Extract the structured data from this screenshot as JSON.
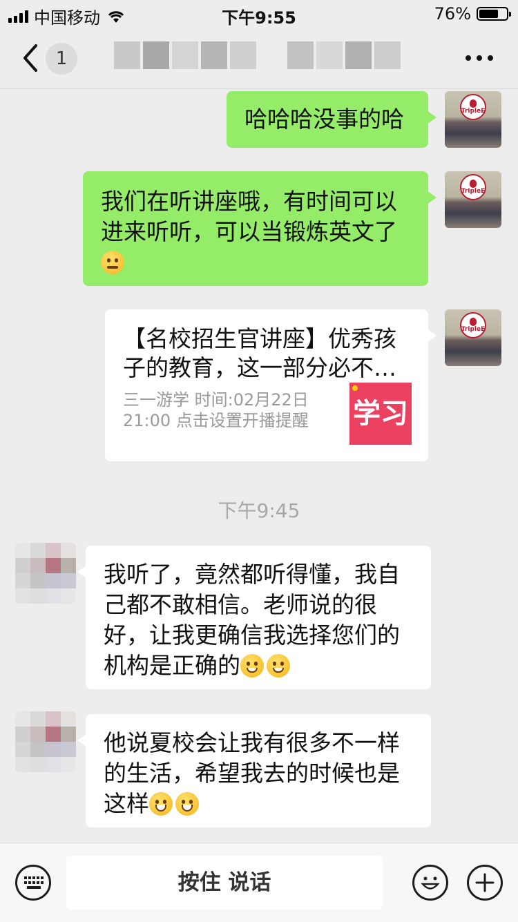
{
  "status_bar": {
    "carrier": "中国移动",
    "time": "下午9:55",
    "battery_text": "76%",
    "battery_level": 0.76
  },
  "nav": {
    "back_count": "1",
    "more_icon": "more-icon"
  },
  "messages": [
    {
      "side": "right",
      "type": "text",
      "text": "哈哈哈没事的哈"
    },
    {
      "side": "right",
      "type": "text",
      "lines": [
        "我们在听讲座哦，有时间可以",
        "进来听听，可以当锻炼英文了"
      ],
      "emoji": "thinking-emoji"
    },
    {
      "side": "right",
      "type": "card",
      "title_lines": [
        "【名校招生官讲座】优秀孩",
        "子的教育，这一部分必不…"
      ],
      "meta_lines": [
        "三一游学 时间:02月22日",
        "21:00 点击设置开播提醒"
      ],
      "thumb_text": "学习"
    }
  ],
  "timestamp": "下午9:45",
  "incoming": [
    {
      "side": "left",
      "type": "text",
      "lines": [
        "我听了，竟然都听得懂，我自",
        "己都不敢相信。老师说的很",
        "好，让我更确信我选择您们的",
        "机构是正确的"
      ],
      "emoji": "blushing-emoji"
    },
    {
      "side": "left",
      "type": "text",
      "lines": [
        "他说夏校会让我有很多不一样",
        "的生活，希望我去的时候也是",
        "这样"
      ],
      "emoji": "grinning-emoji"
    }
  ],
  "avatar_logo_text": "TripleE",
  "toolbar": {
    "voice_label": "按住 说话",
    "keyboard_icon": "keyboard-icon",
    "emoji_icon": "emoji-face-icon",
    "plus_icon": "plus-icon"
  },
  "colors": {
    "background": "#ededed",
    "outgoing_bubble": "#95ec69",
    "incoming_bubble": "#ffffff",
    "timestamp": "#a8a8a8",
    "card_thumb": "#ec4060"
  }
}
